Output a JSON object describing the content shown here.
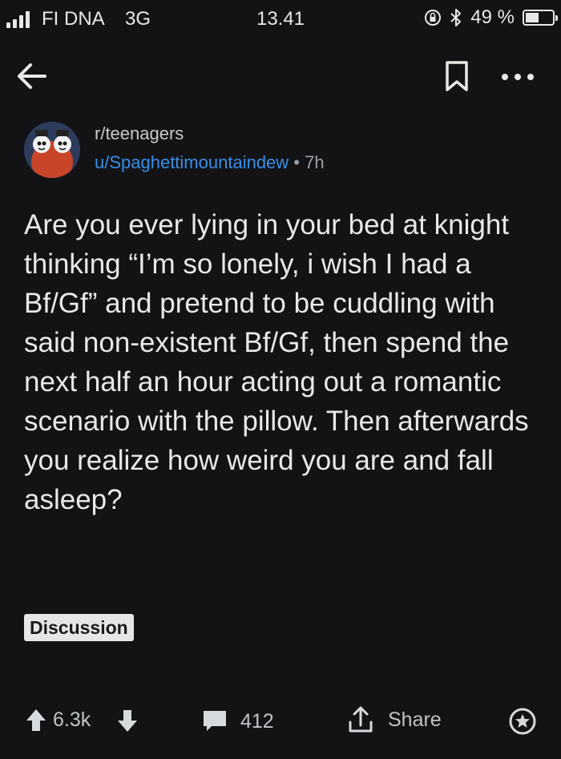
{
  "status_bar": {
    "carrier": "FI DNA",
    "network": "3G",
    "time": "13.41",
    "battery_percent_label": "49 %",
    "battery_level": 0.49,
    "icons": [
      "signal-icon",
      "orientation-lock-icon",
      "bluetooth-icon",
      "battery-icon"
    ]
  },
  "nav": {
    "icons": [
      "back-arrow-icon",
      "bookmark-icon",
      "more-dots-icon"
    ]
  },
  "post": {
    "subreddit": "r/teenagers",
    "author": "u/Spaghettimountaindew",
    "separator": "•",
    "age": "7h",
    "title": "Are you ever lying in your bed at knight thinking “I’m so lonely, i wish I had a Bf/Gf” and pretend to be cuddling with said non-existent Bf/Gf, then spend the next half an hour acting out a romantic scenario with the pillow. Then afterwards you realize how weird you are and fall asleep?",
    "flair": "Discussion"
  },
  "actions": {
    "score": "6.3k",
    "comments": "412",
    "share_label": "Share",
    "icons": [
      "upvote-icon",
      "downvote-icon",
      "comment-icon",
      "share-icon",
      "award-icon"
    ]
  },
  "colors": {
    "background": "#131316",
    "text": "#e8e8e8",
    "author_link": "#3a8ee6",
    "flair_bg": "#e6e6e6"
  }
}
